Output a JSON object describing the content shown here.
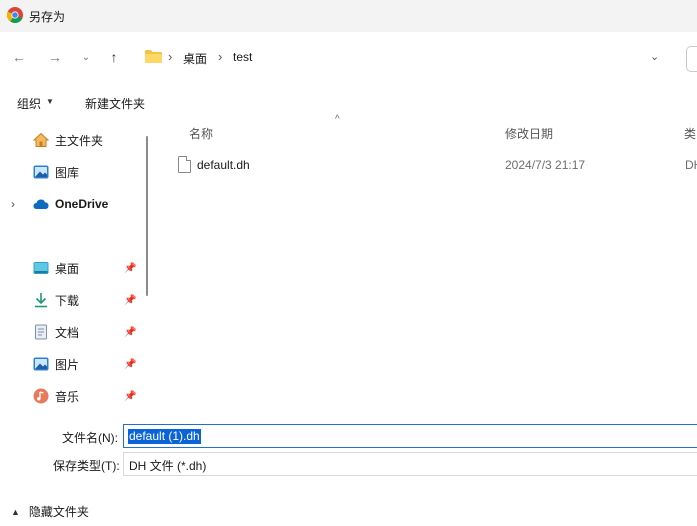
{
  "window": {
    "title": "另存为"
  },
  "nav": {
    "back_icon": "arrow-left-icon",
    "forward_icon": "arrow-right-icon",
    "recent_icon": "chevron-down-icon",
    "up_icon": "arrow-up-icon",
    "breadcrumb": [
      "桌面",
      "test"
    ]
  },
  "toolbar": {
    "organize_label": "组织",
    "new_folder_label": "新建文件夹"
  },
  "sidebar": {
    "items": [
      {
        "label": "主文件夹",
        "icon": "home-icon",
        "pinned": false
      },
      {
        "label": "图库",
        "icon": "gallery-icon",
        "pinned": false
      },
      {
        "label": "OneDrive",
        "icon": "cloud-icon",
        "pinned": false,
        "expandable": true
      },
      {
        "label": "桌面",
        "icon": "desktop-icon",
        "pinned": true
      },
      {
        "label": "下载",
        "icon": "download-icon",
        "pinned": true
      },
      {
        "label": "文档",
        "icon": "document-icon",
        "pinned": true
      },
      {
        "label": "图片",
        "icon": "pictures-icon",
        "pinned": true
      },
      {
        "label": "音乐",
        "icon": "music-icon",
        "pinned": true
      }
    ]
  },
  "file_list": {
    "columns": [
      "名称",
      "修改日期",
      "类"
    ],
    "rows": [
      {
        "name": "default.dh",
        "modified": "2024/7/3 21:17",
        "type": "DH"
      }
    ]
  },
  "form": {
    "filename_label": "文件名(N):",
    "filename_value": "default (1).dh",
    "filetype_label": "保存类型(T):",
    "filetype_value": "DH 文件 (*.dh)"
  },
  "footer": {
    "hide_folders_label": "隐藏文件夹"
  },
  "colors": {
    "accent": "#0a64d8",
    "folder": "#f4c247",
    "onedrive": "#0f6cbd"
  }
}
